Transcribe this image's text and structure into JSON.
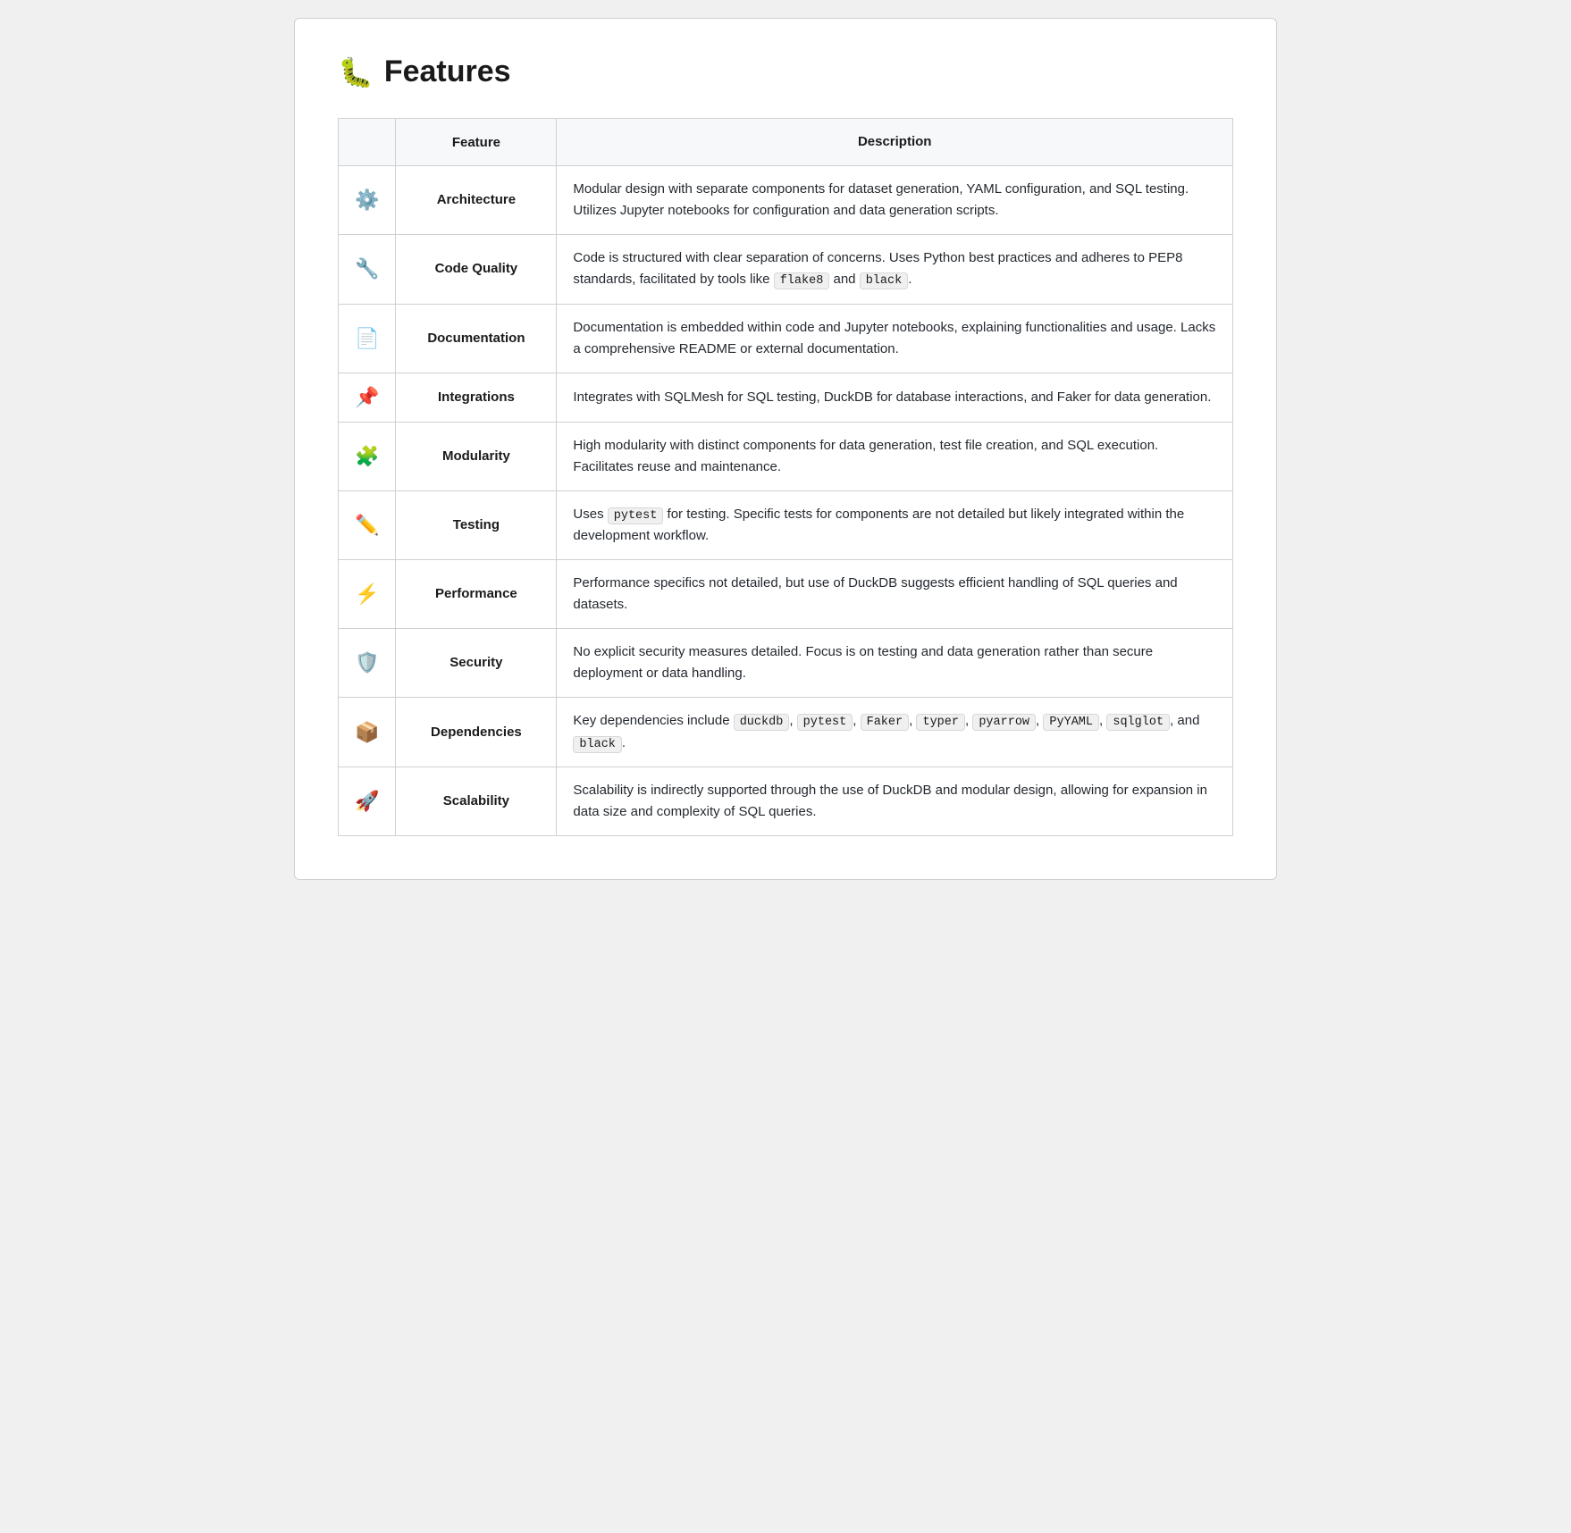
{
  "page": {
    "title": "Features",
    "title_emoji": "🐛"
  },
  "table": {
    "headers": {
      "icon": "",
      "feature": "Feature",
      "description": "Description"
    },
    "rows": [
      {
        "icon": "⚙️",
        "feature": "Architecture",
        "description_parts": [
          {
            "type": "text",
            "content": "Modular design with separate components for dataset generation, YAML configuration, and SQL testing. Utilizes Jupyter notebooks for configuration and data generation scripts."
          }
        ]
      },
      {
        "icon": "🔧",
        "feature": "Code Quality",
        "description_parts": [
          {
            "type": "mixed",
            "before": "Code is structured with clear separation of concerns. Uses Python best practices and adheres to PEP8 standards, facilitated by tools like ",
            "codes": [
              "flake8",
              "black"
            ],
            "connector": " and ",
            "after": "."
          }
        ]
      },
      {
        "icon": "📄",
        "feature": "Documentation",
        "description_parts": [
          {
            "type": "text",
            "content": "Documentation is embedded within code and Jupyter notebooks, explaining functionalities and usage. Lacks a comprehensive README or external documentation."
          }
        ]
      },
      {
        "icon": "📌",
        "feature": "Integrations",
        "description_parts": [
          {
            "type": "text",
            "content": "Integrates with SQLMesh for SQL testing, DuckDB for database interactions, and Faker for data generation."
          }
        ]
      },
      {
        "icon": "🧩",
        "feature": "Modularity",
        "description_parts": [
          {
            "type": "text",
            "content": "High modularity with distinct components for data generation, test file creation, and SQL execution. Facilitates reuse and maintenance."
          }
        ]
      },
      {
        "icon": "✏️",
        "feature": "Testing",
        "description_parts": [
          {
            "type": "mixed_single",
            "before": "Uses ",
            "code": "pytest",
            "after": " for testing. Specific tests for components are not detailed but likely integrated within the development workflow."
          }
        ]
      },
      {
        "icon": "⚡",
        "feature": "Performance",
        "description_parts": [
          {
            "type": "text",
            "content": "Performance specifics not detailed, but use of DuckDB suggests efficient handling of SQL queries and datasets."
          }
        ]
      },
      {
        "icon": "🛡️",
        "feature": "Security",
        "description_parts": [
          {
            "type": "text",
            "content": "No explicit security measures detailed. Focus is on testing and data generation rather than secure deployment or data handling."
          }
        ]
      },
      {
        "icon": "📦",
        "feature": "Dependencies",
        "description_parts": [
          {
            "type": "dependencies",
            "before": "Key dependencies include ",
            "codes": [
              "duckdb",
              "pytest",
              "Faker",
              "typer",
              "pyarrow",
              "PyYAML",
              "sqlglot"
            ],
            "after": " and ",
            "last_code": "black",
            "end": "."
          }
        ]
      },
      {
        "icon": "🚀",
        "feature": "Scalability",
        "description_parts": [
          {
            "type": "text",
            "content": "Scalability is indirectly supported through the use of DuckDB and modular design, allowing for expansion in data size and complexity of SQL queries."
          }
        ]
      }
    ]
  }
}
